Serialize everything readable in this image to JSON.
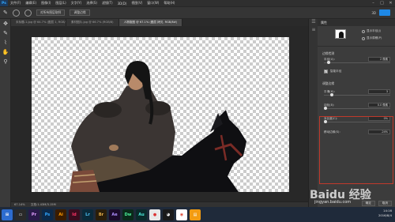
{
  "menubar": {
    "logo": "Ps",
    "items": [
      "文件(F)",
      "编辑(E)",
      "图像(I)",
      "图层(L)",
      "文字(Y)",
      "选择(S)",
      "滤镜(T)",
      "3D(D)",
      "视图(V)",
      "窗口(W)",
      "帮助(H)"
    ]
  },
  "options": {
    "mode_button": "调整边缘",
    "sample_button": "对所有图层取样",
    "all_layers_label": "3D"
  },
  "tabs": [
    {
      "label": "未标题-1.jpg @ 64.7% (图层 1, RGB/8)"
    },
    {
      "label": "素材图片.jpg @ 66.7% (RGB/8)"
    },
    {
      "label": "人物抠图 @ 67.1% (图层 拷贝, RGB/8#)"
    }
  ],
  "status": {
    "zoom": "67.14%",
    "doc": "文档:1.43M/3.15M"
  },
  "panel": {
    "title": "属性",
    "radio_1": "显示半径(J)",
    "radio_2": "显示原稿(P)",
    "section_view": "边缘检测",
    "radius_label": "半径(U):",
    "radius_value": "2 像素",
    "smart_radius": "智能半径",
    "section_adjust": "调整边缘",
    "smooth_label": "平滑(H):",
    "smooth_value": "3",
    "feather_label": "羽化(E):",
    "feather_value": "0.0 像素",
    "contrast_label": "对比度(C):",
    "contrast_value": "0%",
    "shift_label": "移动边缘(S):",
    "shift_value": "-24%",
    "ok_button": "确定",
    "cancel_button": "取消"
  },
  "taskbar": {
    "icons": [
      "Pr",
      "Ps",
      "Ai",
      "Id",
      "Lr",
      "Br",
      "Ae",
      "Dw",
      "Au"
    ],
    "time": "14:16",
    "date": "2016/8/4"
  },
  "watermark": {
    "brand": "Baidu 经验",
    "url": "jingyan.baidu.com"
  },
  "colors": {
    "accent": "#1e88e5",
    "highlight": "#c0392b"
  }
}
